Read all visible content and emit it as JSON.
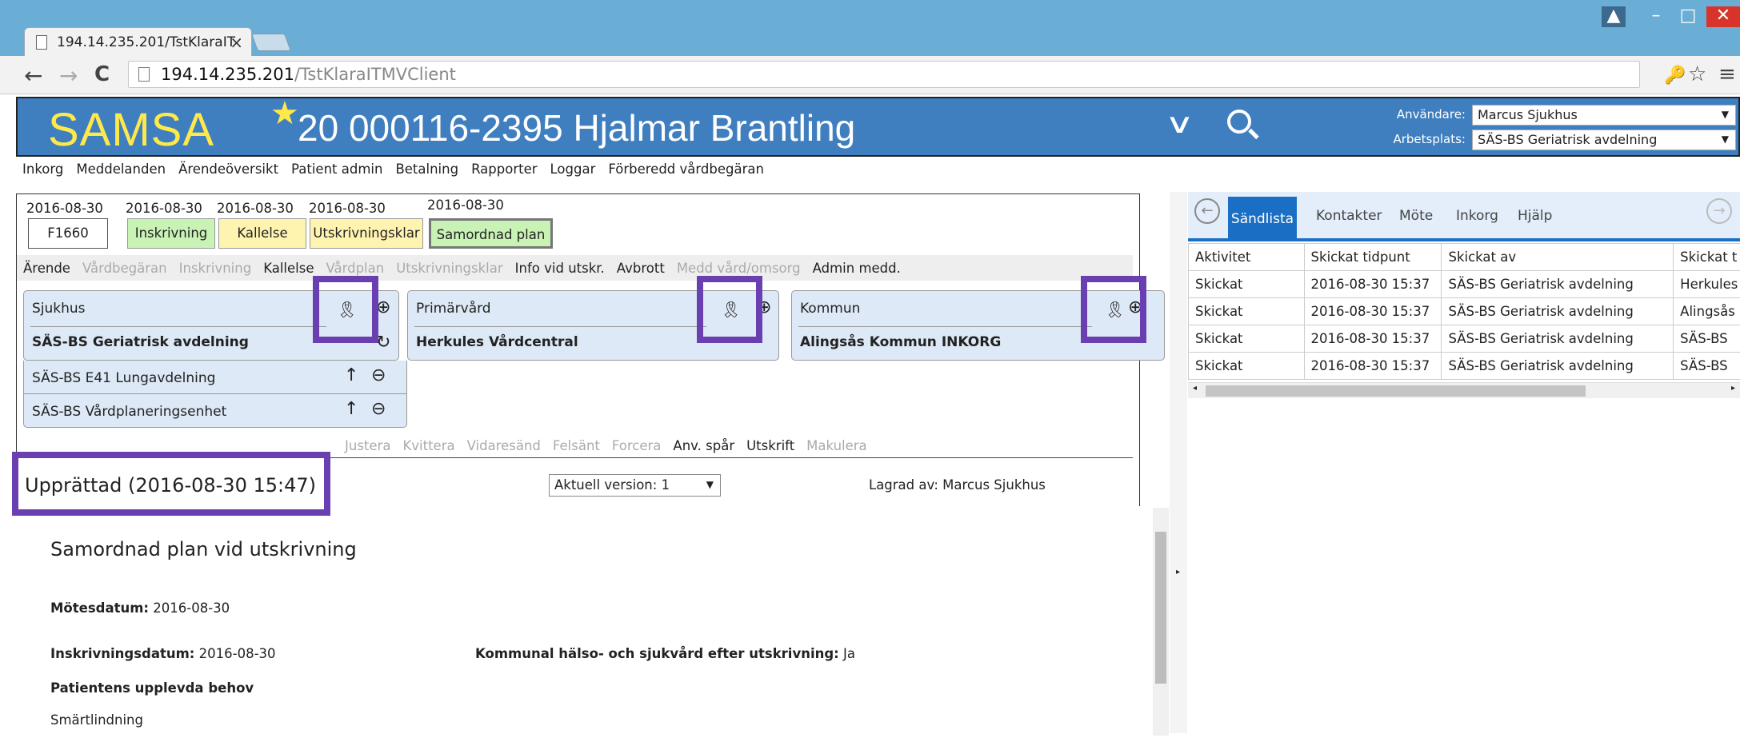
{
  "browser": {
    "tab_title": "194.14.235.201/TstKlaraIT",
    "tab_close": "×",
    "url_host": "194.14.235.201",
    "url_path": "/TstKlaraITMVClient",
    "back": "←",
    "forward": "→",
    "reload": "C",
    "win_user": "▲",
    "win_min": "–",
    "win_max": "□",
    "win_close": "✕",
    "key_icon": "🔑",
    "star_icon": "☆",
    "menu_icon": "≡"
  },
  "header": {
    "logo": "SAMSA",
    "star": "★",
    "patient": "20 000116-2395 Hjalmar Brantling",
    "chevron": "∨",
    "user_label": "Användare:",
    "user_value": "Marcus Sjukhus",
    "workplace_label": "Arbetsplats:",
    "workplace_value": "SÄS-BS Geriatrisk avdelning"
  },
  "main_menu": [
    "Inkorg",
    "Meddelanden",
    "Ärendeöversikt",
    "Patient admin",
    "Betalning",
    "Rapporter",
    "Loggar",
    "Förberedd vårdbegäran"
  ],
  "flow": {
    "dates": [
      "2016-08-30",
      "2016-08-30",
      "2016-08-30",
      "2016-08-30",
      "2016-08-30"
    ],
    "steps": [
      "F1660",
      "Inskrivning",
      "Kallelse",
      "Utskrivningsklar",
      "Samordnad plan"
    ]
  },
  "case_menu": [
    {
      "label": "Ärende",
      "enabled": true
    },
    {
      "label": "Vårdbegäran",
      "enabled": false
    },
    {
      "label": "Inskrivning",
      "enabled": false
    },
    {
      "label": "Kallelse",
      "enabled": true
    },
    {
      "label": "Vårdplan",
      "enabled": false
    },
    {
      "label": "Utskrivningsklar",
      "enabled": false
    },
    {
      "label": "Info vid utskr.",
      "enabled": true
    },
    {
      "label": "Avbrott",
      "enabled": true
    },
    {
      "label": "Medd vård/omsorg",
      "enabled": false
    },
    {
      "label": "Admin medd.",
      "enabled": true
    }
  ],
  "cards": {
    "sjukhus": {
      "title": "Sjukhus",
      "value": "SÄS-BS Geriatrisk avdelning",
      "rows": [
        "SÄS-BS E41 Lungavdelning",
        "SÄS-BS Vårdplaneringsenhet"
      ]
    },
    "primarvard": {
      "title": "Primärvård",
      "value": "Herkules Vårdcentral"
    },
    "kommun": {
      "title": "Kommun",
      "value": "Alingsås Kommun INKORG"
    }
  },
  "action_menu": [
    {
      "label": "Justera",
      "enabled": false
    },
    {
      "label": "Kvittera",
      "enabled": false
    },
    {
      "label": "Vidaresänd",
      "enabled": false
    },
    {
      "label": "Felsänt",
      "enabled": false
    },
    {
      "label": "Forcera",
      "enabled": false
    },
    {
      "label": "Anv. spår",
      "enabled": true
    },
    {
      "label": "Utskrift",
      "enabled": true
    },
    {
      "label": "Makulera",
      "enabled": false
    }
  ],
  "document": {
    "status": "Upprättad (2016-08-30 15:47)",
    "version": "Aktuell version: 1",
    "saved_by": "Lagrad av: Marcus Sjukhus",
    "title": "Samordnad plan vid utskrivning",
    "meeting_label": "Mötesdatum:",
    "meeting_value": " 2016-08-30",
    "inskr_label": "Inskrivningsdatum:",
    "inskr_value": " 2016-08-30",
    "kommunal_label": "Kommunal hälso- och sjukvård efter utskrivning:",
    "kommunal_value": " Ja",
    "needs_label": "Patientens upplevda behov",
    "needs_value": "Smärtlindning"
  },
  "right_panel": {
    "tabs": [
      "Sändlista",
      "Kontakter",
      "Möte",
      "Inkorg",
      "Hjälp"
    ],
    "columns": [
      "Aktivitet",
      "Skickat tidpunt",
      "Skickat av",
      "Skickat t"
    ],
    "rows": [
      [
        "Skickat",
        "2016-08-30 15:37",
        "SÄS-BS Geriatrisk avdelning",
        "Herkules"
      ],
      [
        "Skickat",
        "2016-08-30 15:37",
        "SÄS-BS Geriatrisk avdelning",
        "Alingsås"
      ],
      [
        "Skickat",
        "2016-08-30 15:37",
        "SÄS-BS Geriatrisk avdelning",
        "SÄS-BS"
      ],
      [
        "Skickat",
        "2016-08-30 15:37",
        "SÄS-BS Geriatrisk avdelning",
        "SÄS-BS"
      ]
    ]
  },
  "colors": {
    "header_bg": "#3f7fbf",
    "logo": "#ffe94a",
    "step_green": "#c9f2b5",
    "step_yellow": "#fff3b0",
    "highlight": "#6a3fb0",
    "tab_active": "#1a6fc4"
  }
}
